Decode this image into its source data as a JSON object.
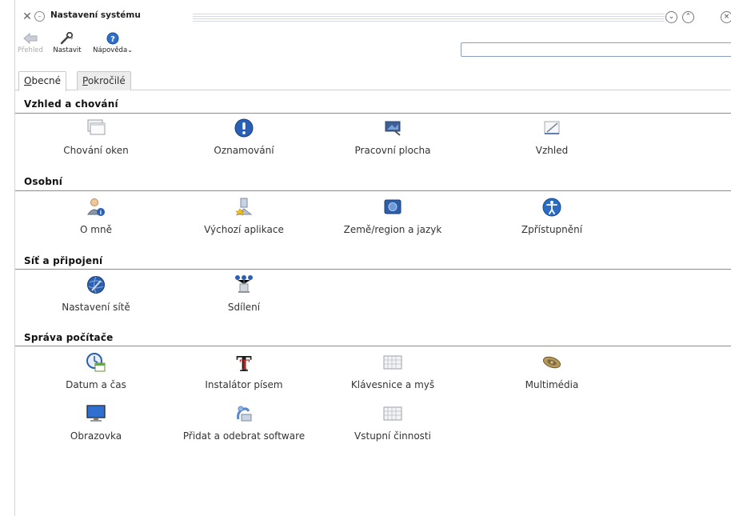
{
  "window": {
    "title": "Nastavení systému"
  },
  "toolbar": {
    "back_label": "Přehled",
    "configure_label": "Nastavit",
    "help_label": "Nápověda",
    "search": {
      "value": "",
      "placeholder": ""
    }
  },
  "tabs": [
    {
      "accel": "O",
      "rest": "becné"
    },
    {
      "accel": "P",
      "rest": "okročilé"
    }
  ],
  "sections": [
    {
      "title": "Vzhled a chování",
      "items": [
        {
          "label": "Chování oken",
          "icon": "window-behavior-icon"
        },
        {
          "label": "Oznamování",
          "icon": "notification-icon"
        },
        {
          "label": "Pracovní plocha",
          "icon": "desktop-icon"
        },
        {
          "label": "Vzhled",
          "icon": "appearance-icon"
        }
      ]
    },
    {
      "title": "Osobní",
      "items": [
        {
          "label": "O mně",
          "icon": "about-me-icon"
        },
        {
          "label": "Výchozí aplikace",
          "icon": "default-apps-icon"
        },
        {
          "label": "Země/region a jazyk",
          "icon": "locale-icon"
        },
        {
          "label": "Zpřístupnění",
          "icon": "accessibility-icon"
        }
      ]
    },
    {
      "title": "Síť a připojení",
      "items": [
        {
          "label": "Nastavení sítě",
          "icon": "network-settings-icon"
        },
        {
          "label": "Sdílení",
          "icon": "sharing-icon"
        }
      ]
    },
    {
      "title": "Správa počítače",
      "items": [
        {
          "label": "Datum a čas",
          "icon": "date-time-icon"
        },
        {
          "label": "Instalátor písem",
          "icon": "font-installer-icon"
        },
        {
          "label": "Klávesnice a myš",
          "icon": "keyboard-mouse-icon"
        },
        {
          "label": "Multimédia",
          "icon": "multimedia-icon"
        },
        {
          "label": "Obrazovka",
          "icon": "display-icon"
        },
        {
          "label": "Přidat a odebrat software",
          "icon": "software-icon"
        },
        {
          "label": "Vstupní činnosti",
          "icon": "input-actions-icon"
        }
      ]
    }
  ]
}
